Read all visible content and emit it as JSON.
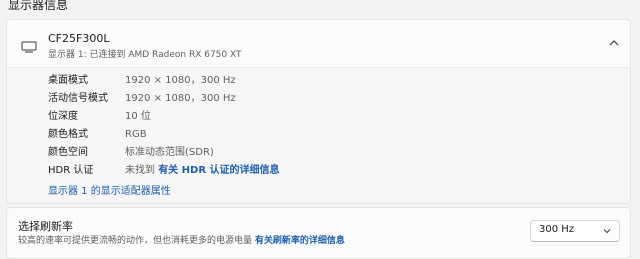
{
  "section": {
    "title": "显示器信息"
  },
  "monitor": {
    "name": "CF25F300L",
    "subtitle": "显示器 1: 已连接到 AMD Radeon RX 6750 XT"
  },
  "details": [
    {
      "label": "桌面模式",
      "value": "1920 × 1080，300 Hz"
    },
    {
      "label": "活动信号模式",
      "value": "1920 × 1080，300 Hz"
    },
    {
      "label": "位深度",
      "value": "10 位"
    },
    {
      "label": "颜色格式",
      "value": "RGB"
    },
    {
      "label": "颜色空间",
      "value": "标准动态范围(SDR)"
    }
  ],
  "hdr": {
    "label": "HDR 认证",
    "value_prefix": "未找到",
    "link": "有关 HDR 认证的详细信息"
  },
  "adapter_link": "显示器 1 的显示适配器属性",
  "refresh": {
    "title": "选择刷新率",
    "desc": "较高的速率可提供更流畅的动作，但也消耗更多的电源电量",
    "link": "有关刷新率的详细信息",
    "selected": "300 Hz"
  }
}
